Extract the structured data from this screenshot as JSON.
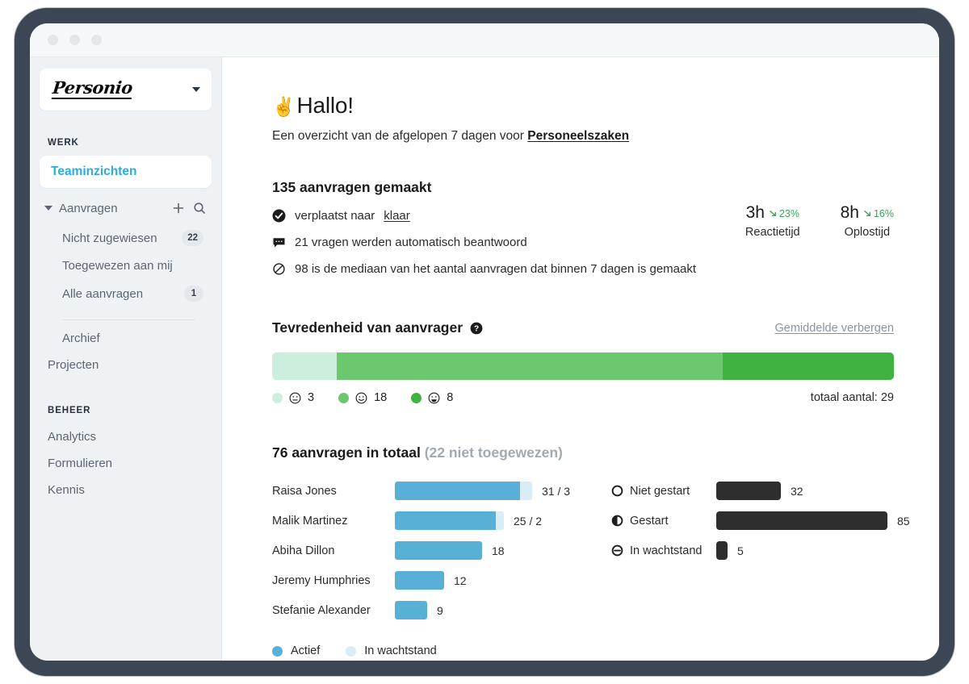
{
  "window": {
    "dots": [
      "dot-red",
      "dot-yellow",
      "dot-green"
    ]
  },
  "sidebar": {
    "brand": "Personio",
    "brand_caret_icon": "chevron-down-icon",
    "sections": [
      {
        "label": "WERK",
        "active_item": "Teaminzichten",
        "group": {
          "label": "Aanvragen",
          "expand_icon": "caret-down-icon",
          "add_icon": "plus-icon",
          "search_icon": "search-icon"
        },
        "items": [
          {
            "label": "Nicht zugewiesen",
            "badge": "22"
          },
          {
            "label": "Toegewezen aan mij",
            "badge": ""
          },
          {
            "label": "Alle aanvragen",
            "badge": "1"
          }
        ],
        "after_divider": [
          {
            "label": "Archief",
            "indent": true
          },
          {
            "label": "Projecten",
            "indent": false
          }
        ]
      },
      {
        "label": "BEHEER",
        "items": [
          {
            "label": "Analytics"
          },
          {
            "label": "Formulieren"
          },
          {
            "label": "Kennis"
          }
        ]
      }
    ]
  },
  "main": {
    "greeting_emoji": "✌️",
    "greeting": "Hallo!",
    "subtitle_prefix": "Een overzicht van de afgelopen 7 dagen voor ",
    "subtitle_link": "Personeelszaken",
    "stats": {
      "title": "135 aanvragen gemaakt",
      "lines": [
        {
          "icon": "check-circle-icon",
          "text_prefix": "verplaatst naar ",
          "link": "klaar",
          "text_suffix": ""
        },
        {
          "icon": "speech-bubble-icon",
          "text_prefix": "21 vragen werden automatisch beantwoord",
          "link": "",
          "text_suffix": ""
        },
        {
          "icon": "median-slash-icon",
          "text_prefix": "98 is de mediaan van het aantal aanvragen dat binnen 7 dagen is gemaakt",
          "link": "",
          "text_suffix": ""
        }
      ],
      "kpis": [
        {
          "value": "3h",
          "delta": "23%",
          "delta_icon": "arrow-down-right-icon",
          "label": "Reactietijd",
          "delta_color": "#3aa05a"
        },
        {
          "value": "8h",
          "delta": "16%",
          "delta_icon": "arrow-down-right-icon",
          "label": "Oplostijd",
          "delta_color": "#3aa05a"
        }
      ]
    },
    "satisfaction": {
      "title": "Tevredenheid van aanvrager",
      "help_icon": "help-circle-icon",
      "toggle_label": "Gemiddelde verbergen",
      "total_label": "totaal aantal: 29",
      "segments": [
        {
          "count": "3",
          "color": "#cdeedd",
          "face_icon": "face-neutral-icon"
        },
        {
          "count": "18",
          "color": "#6cc86e",
          "face_icon": "face-smile-icon"
        },
        {
          "count": "8",
          "color": "#40b241",
          "face_icon": "face-grin-icon"
        }
      ]
    },
    "requests": {
      "title_main": "76 aanvragen in totaal",
      "title_muted": "(22 niet toegewezen)",
      "people": [
        {
          "name": "Raisa Jones",
          "active": 31,
          "pending": 3,
          "value": "31 / 3"
        },
        {
          "name": "Malik Martinez",
          "active": 25,
          "pending": 2,
          "value": "25 / 2"
        },
        {
          "name": "Abiha Dillon",
          "active": 18,
          "pending": 0,
          "value": "18"
        },
        {
          "name": "Jeremy Humphries",
          "active": 12,
          "pending": 0,
          "value": "12"
        },
        {
          "name": "Stefanie Alexander",
          "active": 9,
          "pending": 0,
          "value": "9"
        }
      ],
      "statuses": [
        {
          "label": "Niet gestart",
          "value": 32,
          "display": "32",
          "icon": "circle-empty-icon"
        },
        {
          "label": "Gestart",
          "value": 85,
          "display": "85",
          "icon": "circle-half-icon"
        },
        {
          "label": "In wachtstand",
          "value": 5,
          "display": "5",
          "icon": "circle-minus-icon"
        }
      ],
      "legend": [
        {
          "label": "Actief",
          "color": "#58b0d7"
        },
        {
          "label": "In wachtstand",
          "color": "#d9edf6"
        }
      ]
    }
  },
  "chart_data": [
    {
      "type": "bar",
      "title": "Tevredenheid van aanvrager",
      "orientation": "horizontal-stacked",
      "categories": [
        "neutraal",
        "tevreden",
        "zeer tevreden"
      ],
      "values": [
        3,
        18,
        8
      ],
      "colors": [
        "#cdeedd",
        "#6cc86e",
        "#40b241"
      ],
      "total": 29,
      "xlabel": "",
      "ylabel": ""
    },
    {
      "type": "bar",
      "title": "76 aanvragen in totaal (22 niet toegewezen)",
      "orientation": "horizontal",
      "categories": [
        "Raisa Jones",
        "Malik Martinez",
        "Abiha Dillon",
        "Jeremy Humphries",
        "Stefanie Alexander"
      ],
      "series": [
        {
          "name": "Actief",
          "values": [
            31,
            25,
            18,
            12,
            9
          ],
          "color": "#58b0d7"
        },
        {
          "name": "In wachtstand",
          "values": [
            3,
            2,
            0,
            0,
            0
          ],
          "color": "#d9edf6"
        }
      ],
      "xlim": [
        0,
        34
      ],
      "legend_position": "bottom"
    },
    {
      "type": "bar",
      "title": "Status",
      "orientation": "horizontal",
      "categories": [
        "Niet gestart",
        "Gestart",
        "In wachtstand"
      ],
      "values": [
        32,
        85,
        5
      ],
      "colors": [
        "#2e2e2e",
        "#2e2e2e",
        "#2e2e2e"
      ],
      "xlim": [
        0,
        90
      ]
    }
  ]
}
